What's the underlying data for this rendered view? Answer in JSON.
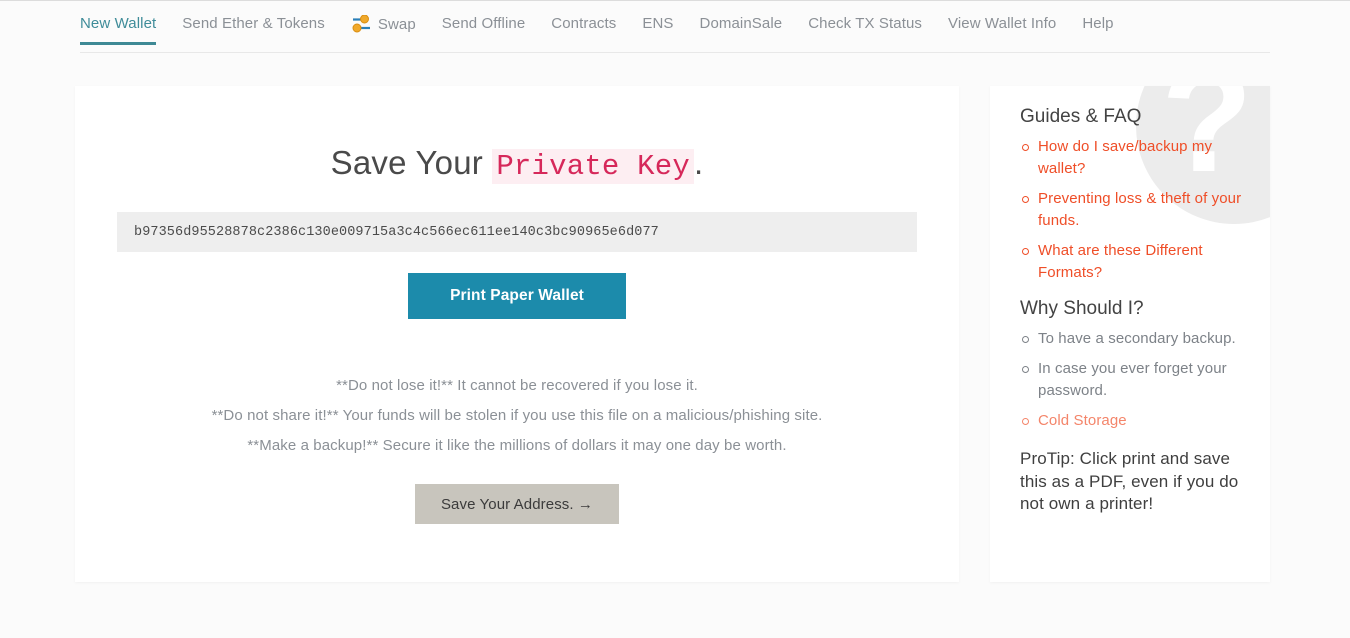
{
  "nav": {
    "items": [
      {
        "label": "New Wallet",
        "active": true,
        "icon": null
      },
      {
        "label": "Send Ether & Tokens",
        "active": false,
        "icon": null
      },
      {
        "label": "Swap",
        "active": false,
        "icon": "swap-icon"
      },
      {
        "label": "Send Offline",
        "active": false,
        "icon": null
      },
      {
        "label": "Contracts",
        "active": false,
        "icon": null
      },
      {
        "label": "ENS",
        "active": false,
        "icon": null
      },
      {
        "label": "DomainSale",
        "active": false,
        "icon": null
      },
      {
        "label": "Check TX Status",
        "active": false,
        "icon": null
      },
      {
        "label": "View Wallet Info",
        "active": false,
        "icon": null
      },
      {
        "label": "Help",
        "active": false,
        "icon": null
      }
    ]
  },
  "main": {
    "title_prefix": "Save Your ",
    "title_key": "Private Key",
    "title_suffix": ".",
    "private_key": "b97356d95528878c2386c130e009715a3c4c566ec611ee140c3bc90965e6d077",
    "print_button": "Print Paper Wallet",
    "warnings": [
      "**Do not lose it!** It cannot be recovered if you lose it.",
      "**Do not share it!** Your funds will be stolen if you use this file on a malicious/phishing site.",
      "**Make a backup!** Secure it like the millions of dollars it may one day be worth."
    ],
    "address_button": "Save Your Address. →"
  },
  "sidebar": {
    "watermark": "?",
    "guides_heading": "Guides & FAQ",
    "guides_items": [
      "How do I save/backup my wallet?",
      "Preventing loss & theft of your funds.",
      "What are these Different Formats?"
    ],
    "why_heading": "Why Should I?",
    "why_items": [
      "To have a secondary backup.",
      "In case you ever forget your password.",
      "Cold Storage"
    ],
    "protip": "ProTip: Click print and save this as a PDF, even if you do not own a printer!"
  },
  "colors": {
    "accent_teal": "#3e8995",
    "print_button": "#1c8bab",
    "key_red": "#d6285a",
    "link_orange": "#ef4e28",
    "link_orange_light": "#f4856a",
    "address_button": "#c8c5bd"
  }
}
